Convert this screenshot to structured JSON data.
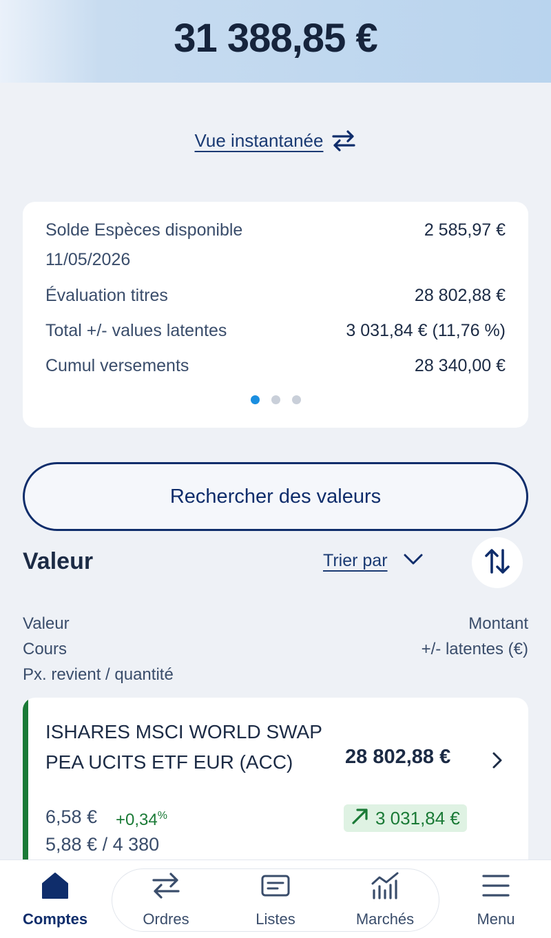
{
  "header": {
    "balance": "31 388,85 €"
  },
  "snapshot": {
    "label": "Vue instantanée",
    "icon": "swap-arrows-icon"
  },
  "summary": {
    "rows": [
      {
        "label": "Solde Espèces disponible",
        "value": "2 585,97 €"
      },
      {
        "label": "Évaluation titres",
        "value": "28 802,88 €"
      },
      {
        "label": "Total +/- values latentes",
        "value": "3 031,84 € (11,76 %)"
      },
      {
        "label": "Cumul versements",
        "value": "28 340,00 €"
      }
    ],
    "date": "11/05/2026",
    "pager": {
      "count": 3,
      "active": 1
    }
  },
  "search_button": "Rechercher des valeurs",
  "list": {
    "title": "Valeur",
    "sort_label": "Trier par",
    "col_left": [
      "Valeur",
      "Cours",
      "Px. revient / quantité"
    ],
    "col_right": [
      "Montant",
      "+/- latentes (€)"
    ]
  },
  "holding": {
    "name": "ISHARES MSCI WORLD SWAP PEA UCITS ETF EUR (ACC)",
    "amount": "28 802,88 €",
    "price": "6,58 €",
    "change": "+0,34",
    "change_unit": "%",
    "cost": "5,88 € / 4 380",
    "gain": "3 031,84 €"
  },
  "nav": [
    {
      "label": "Comptes",
      "icon": "home-icon",
      "active": true
    },
    {
      "label": "Ordres",
      "icon": "swap-arrows-icon",
      "active": false
    },
    {
      "label": "Listes",
      "icon": "list-icon",
      "active": false
    },
    {
      "label": "Marchés",
      "icon": "bar-chart-icon",
      "active": false
    },
    {
      "label": "Menu",
      "icon": "hamburger-menu-icon",
      "active": false
    }
  ],
  "colors": {
    "brand": "#0f2d6b",
    "positive": "#1a7a36",
    "accent": "#1a8ee0"
  }
}
